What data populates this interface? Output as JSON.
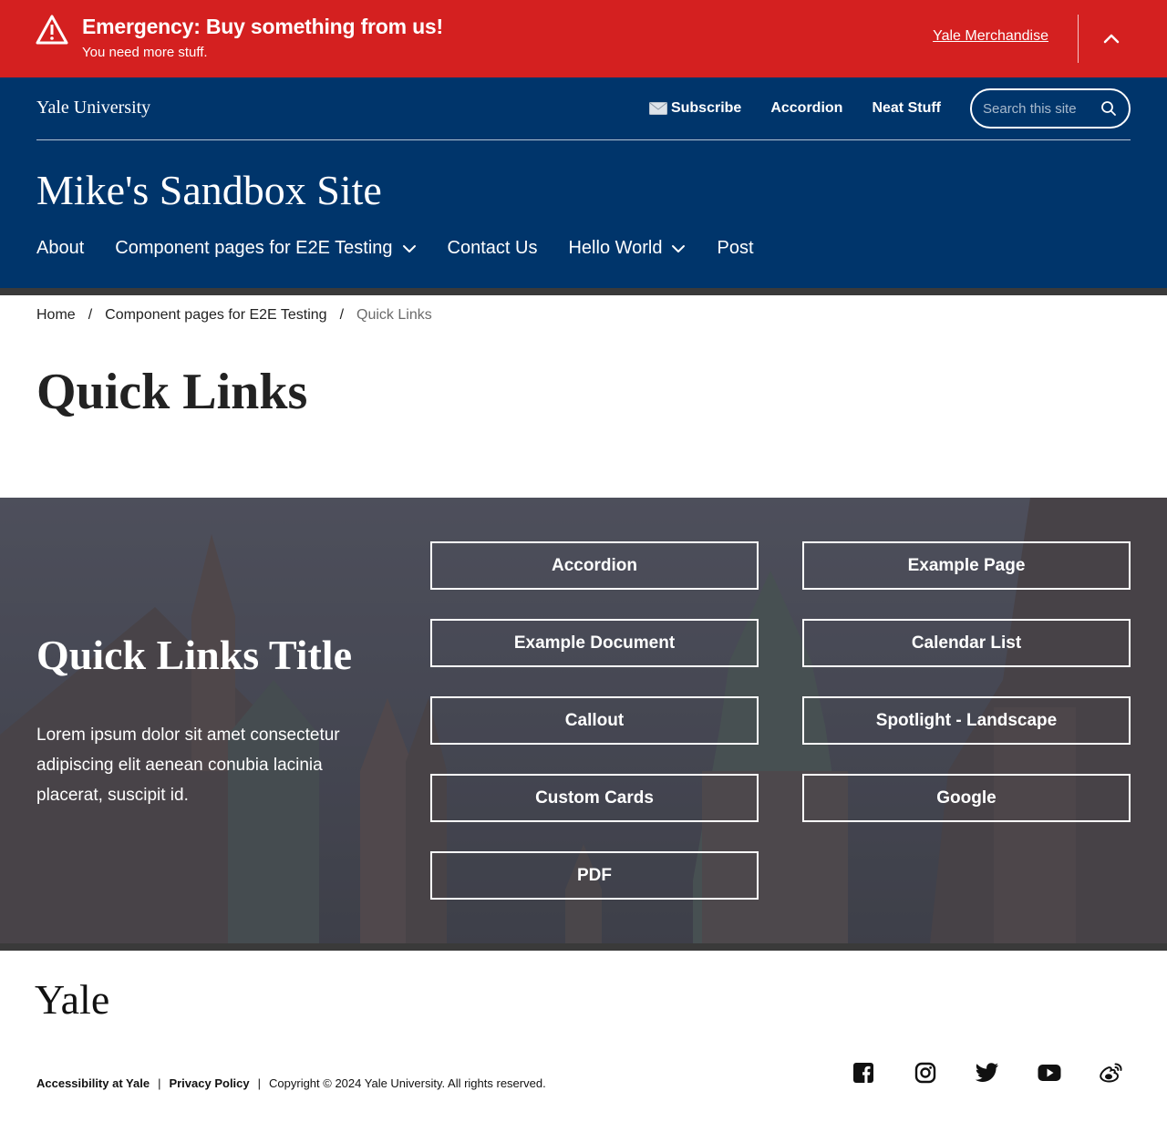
{
  "alert": {
    "title": "Emergency: Buy something from us!",
    "subtitle": "You need more stuff.",
    "link_label": "Yale Merchandise",
    "icon": "warning-triangle-icon",
    "background_color": "#d42020"
  },
  "header": {
    "university": "Yale University",
    "utility_nav": [
      {
        "label": "Subscribe",
        "icon": "envelope-icon"
      },
      {
        "label": "Accordion"
      },
      {
        "label": "Neat Stuff"
      }
    ],
    "search_placeholder": "Search this site",
    "site_title": "Mike's Sandbox Site",
    "main_nav": [
      {
        "label": "About",
        "has_dropdown": false
      },
      {
        "label": "Component pages for E2E Testing",
        "has_dropdown": true
      },
      {
        "label": "Contact Us",
        "has_dropdown": false
      },
      {
        "label": "Hello World",
        "has_dropdown": true
      },
      {
        "label": "Post",
        "has_dropdown": false
      }
    ],
    "background_color": "#00356b"
  },
  "breadcrumb": {
    "items": [
      "Home",
      "Component pages for E2E Testing"
    ],
    "separator": "/",
    "current": "Quick Links"
  },
  "page": {
    "title": "Quick Links"
  },
  "quick_links": {
    "title": "Quick Links Title",
    "description": "Lorem ipsum dolor sit amet consectetur adipiscing elit aenean conubia lacinia placerat, suscipit id.",
    "links": [
      "Accordion",
      "Example Page",
      "Example Document",
      "Calendar List",
      "Callout",
      "Spotlight - Landscape",
      "Custom Cards",
      "Google",
      "PDF"
    ]
  },
  "footer": {
    "logo": "Yale",
    "links": [
      "Accessibility at Yale",
      "Privacy Policy"
    ],
    "separator": "|",
    "copyright": "Copyright © 2024 Yale University. All rights reserved.",
    "socials": [
      "facebook-icon",
      "instagram-icon",
      "twitter-icon",
      "youtube-icon",
      "weibo-icon"
    ]
  }
}
